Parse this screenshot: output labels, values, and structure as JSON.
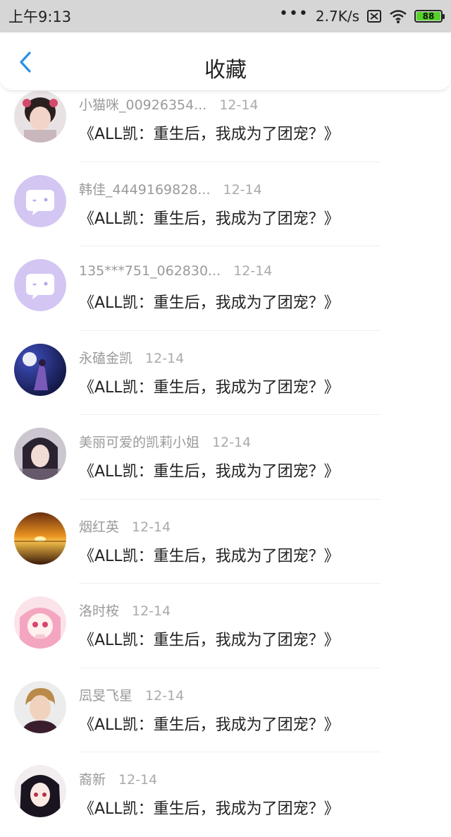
{
  "status_bar": {
    "time": "上午9:13",
    "dots": "•••",
    "speed": "2.7K/s",
    "battery": "88",
    "battery_color": "#56d12a"
  },
  "header": {
    "title": "收藏",
    "back_icon": "chevron-left-icon",
    "accent_color": "#2a8fe6"
  },
  "items": [
    {
      "name": "小猫咪_00926354...",
      "date": "12-14",
      "title": "《ALL凯：重生后，我成为了团宠？》",
      "avatar": "girl-photo"
    },
    {
      "name": "韩佳_4449169828...",
      "date": "12-14",
      "title": "《ALL凯：重生后，我成为了团宠？》",
      "avatar": "default-chat-bubble"
    },
    {
      "name": "135***751_062830...",
      "date": "12-14",
      "title": "《ALL凯：重生后，我成为了团宠？》",
      "avatar": "default-chat-bubble"
    },
    {
      "name": "永磕金凯",
      "date": "12-14",
      "title": "《ALL凯：重生后，我成为了团宠？》",
      "avatar": "night-figure"
    },
    {
      "name": "美丽可爱的凯莉小姐",
      "date": "12-14",
      "title": "《ALL凯：重生后，我成为了团宠？》",
      "avatar": "dark-hair-girl"
    },
    {
      "name": "烟红英",
      "date": "12-14",
      "title": "《ALL凯：重生后，我成为了团宠？》",
      "avatar": "sunset"
    },
    {
      "name": "洛时桉",
      "date": "12-14",
      "title": "《ALL凯：重生后，我成为了团宠？》",
      "avatar": "anime-pink-girl"
    },
    {
      "name": "凨旻飞星",
      "date": "12-14",
      "title": "《ALL凯：重生后，我成为了团宠？》",
      "avatar": "man-portrait"
    },
    {
      "name": "裔新",
      "date": "12-14",
      "title": "《ALL凯：重生后，我成为了团宠？》",
      "avatar": "anime-dark-girl"
    }
  ]
}
